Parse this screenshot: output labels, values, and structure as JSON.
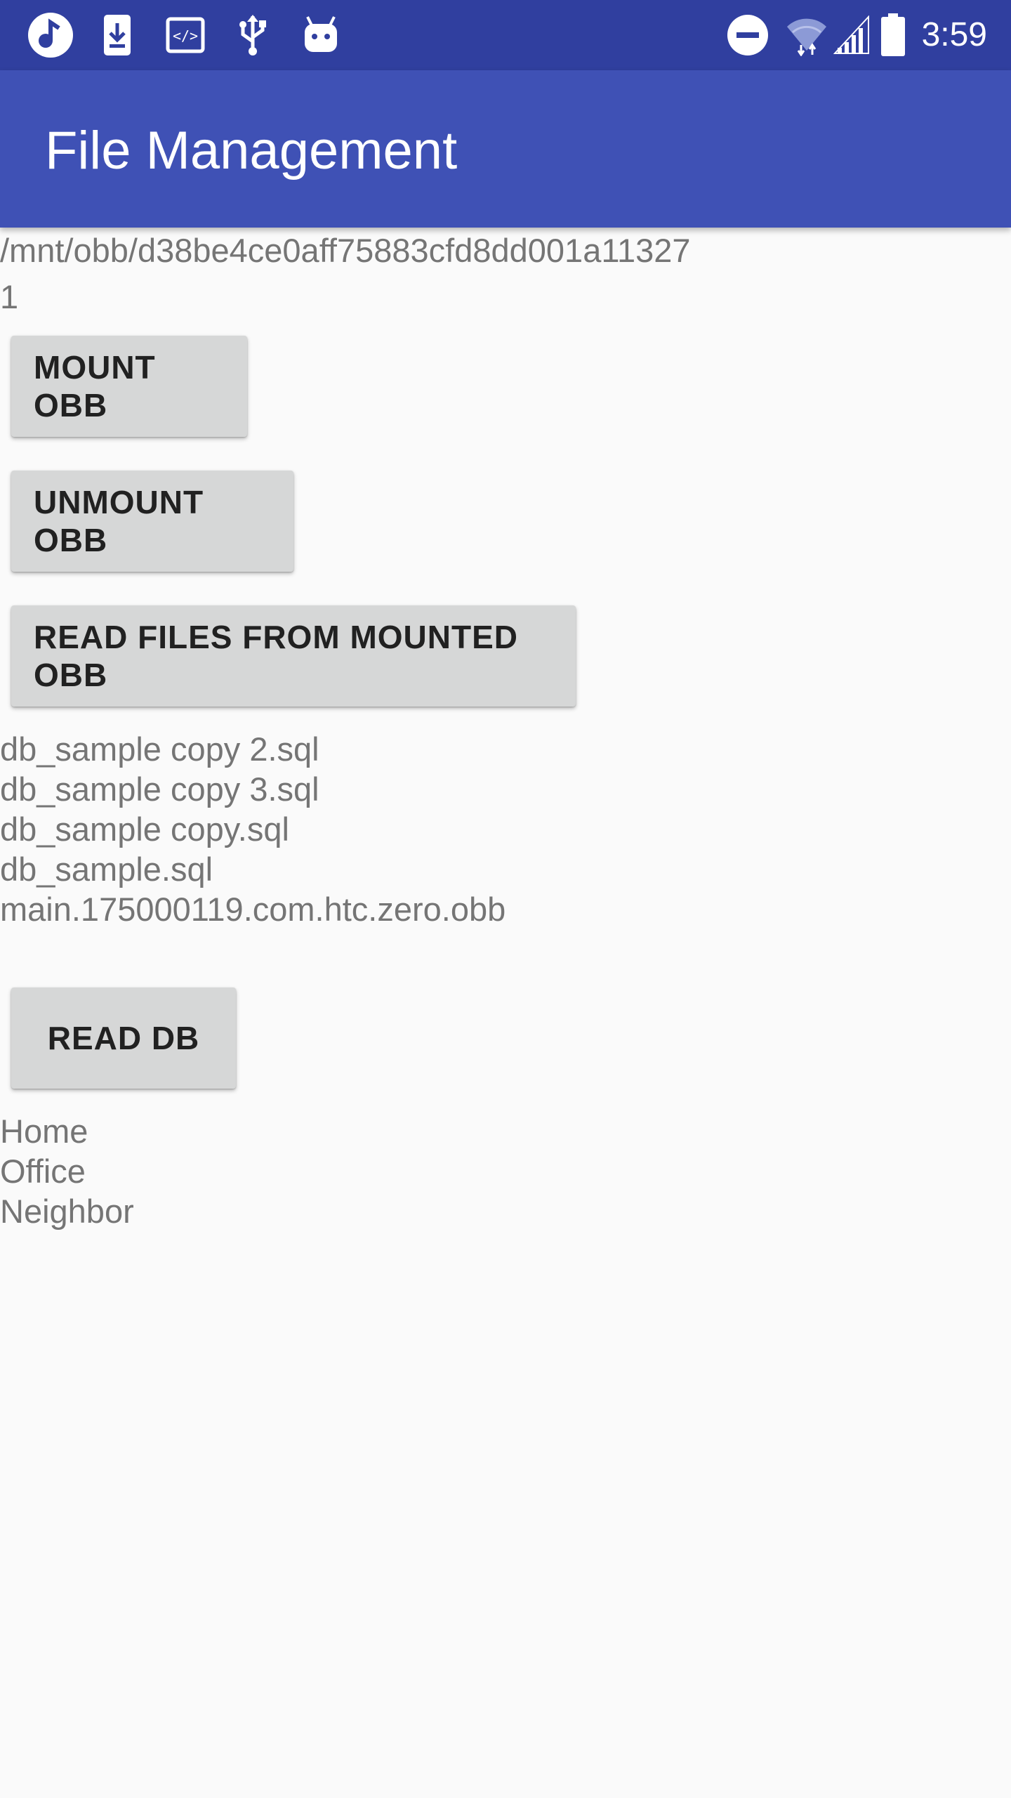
{
  "status_bar": {
    "time": "3:59",
    "left_icons": [
      "app-notification-icon",
      "download-icon",
      "code-icon",
      "usb-icon",
      "android-debug-icon"
    ],
    "right_icons": [
      "do-not-disturb-icon",
      "wifi-icon",
      "cell-signal-icon",
      "battery-icon"
    ],
    "bg_color": "#303f9f"
  },
  "app_bar": {
    "title": "File Management",
    "bg_color": "#3f51b5"
  },
  "main": {
    "obb_path": "/mnt/obb/d38be4ce0aff75883cfd8dd001a11327",
    "mount_status": "1",
    "buttons": {
      "mount": "MOUNT OBB",
      "unmount": "UNMOUNT OBB",
      "read_files": "READ FILES FROM MOUNTED OBB",
      "read_db": "READ DB"
    },
    "files": [
      "db_sample copy 2.sql",
      "db_sample copy 3.sql",
      "db_sample copy.sql",
      "db_sample.sql",
      "main.175000119.com.htc.zero.obb"
    ],
    "db_rows": [
      "Home",
      "Office",
      "Neighbor"
    ]
  }
}
